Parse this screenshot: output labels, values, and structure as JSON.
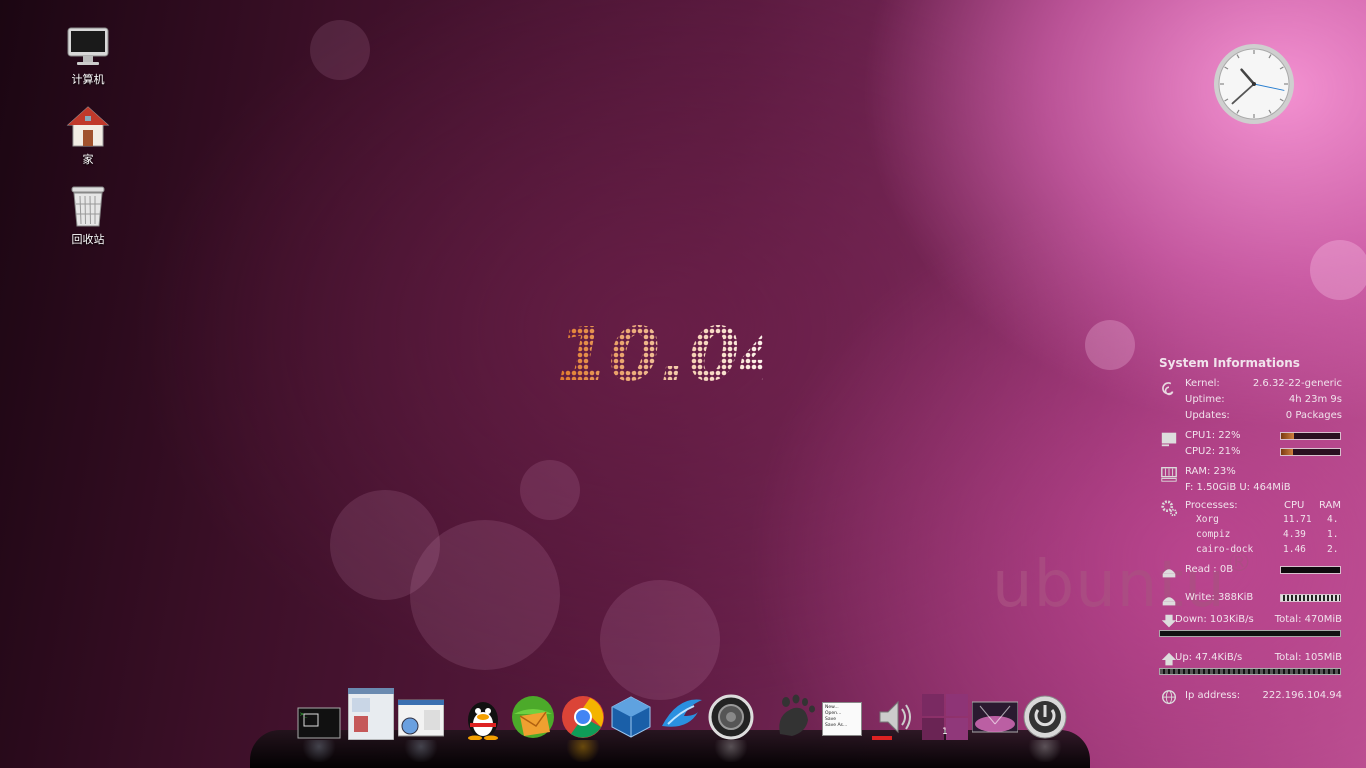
{
  "desktop_icons": [
    {
      "name": "computer",
      "label": "计算机"
    },
    {
      "name": "home",
      "label": "家"
    },
    {
      "name": "trash",
      "label": "回收站"
    }
  ],
  "wallpaper": {
    "version_text": "10.04",
    "brand_text": "ubuntu",
    "brand_mark": "®"
  },
  "clock": {
    "hour": 10,
    "minute": 38,
    "second": 17
  },
  "sysinfo": {
    "title": "System Informations",
    "kernel_label": "Kernel:",
    "kernel_value": "2.6.32-22-generic",
    "uptime_label": "Uptime:",
    "uptime_value": "4h 23m 9s",
    "updates_label": "Updates:",
    "updates_value": "0 Packages",
    "cpu1_label": "CPU1: 22%",
    "cpu1_pct": 22,
    "cpu2_label": "CPU2: 21%",
    "cpu2_pct": 21,
    "ram_label": "RAM: 23%",
    "ram_detail": "F: 1.50GiB U: 464MiB",
    "processes_label": "Processes:",
    "cpu_col": "CPU",
    "ram_col": "RAM",
    "processes": [
      {
        "name": "Xorg",
        "cpu": "11.71",
        "ram": "4."
      },
      {
        "name": "compiz",
        "cpu": "4.39",
        "ram": "1."
      },
      {
        "name": "cairo-dock",
        "cpu": "1.46",
        "ram": "2."
      }
    ],
    "read_label": "Read : 0B",
    "write_label": "Write: 388KiB",
    "down_label": "Down: 103KiB/s",
    "down_total": "Total: 470MiB",
    "up_label": "Up: 47.4KiB/s",
    "up_total": "Total: 105MiB",
    "ip_label": "Ip address:",
    "ip_value": "222.196.104.94"
  },
  "dock": {
    "items": [
      {
        "name": "terminal"
      },
      {
        "name": "file-manager"
      },
      {
        "name": "document-viewer"
      },
      {
        "name": "qq"
      },
      {
        "name": "mail"
      },
      {
        "name": "chrome"
      },
      {
        "name": "virtualbox"
      },
      {
        "name": "messenger"
      },
      {
        "name": "screenshot"
      },
      {
        "name": "gnome"
      },
      {
        "name": "file-menu",
        "menu": [
          "New...",
          "Open...",
          "Save",
          "Save As..."
        ]
      },
      {
        "name": "volume"
      },
      {
        "name": "workspace-switcher",
        "badge": "1"
      },
      {
        "name": "show-desktop"
      },
      {
        "name": "shutdown"
      }
    ]
  },
  "colors": {
    "accent": "#b8508f",
    "bar_fill": "#d08040",
    "text": "#f1e3ec"
  }
}
